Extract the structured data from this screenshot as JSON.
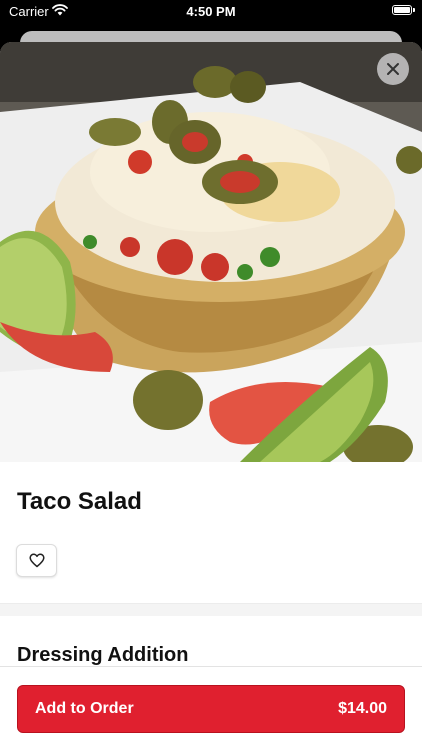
{
  "status_bar": {
    "carrier": "Carrier",
    "time": "4:50 PM"
  },
  "item": {
    "title": "Taco Salad"
  },
  "sections": [
    {
      "title": "Dressing Addition"
    }
  ],
  "footer": {
    "add_label": "Add to Order",
    "price": "$14.00"
  },
  "colors": {
    "accent": "#e0202f"
  },
  "icons": {
    "close": "close-icon",
    "favorite": "heart-outline-icon",
    "wifi": "wifi-icon",
    "battery": "battery-icon"
  }
}
